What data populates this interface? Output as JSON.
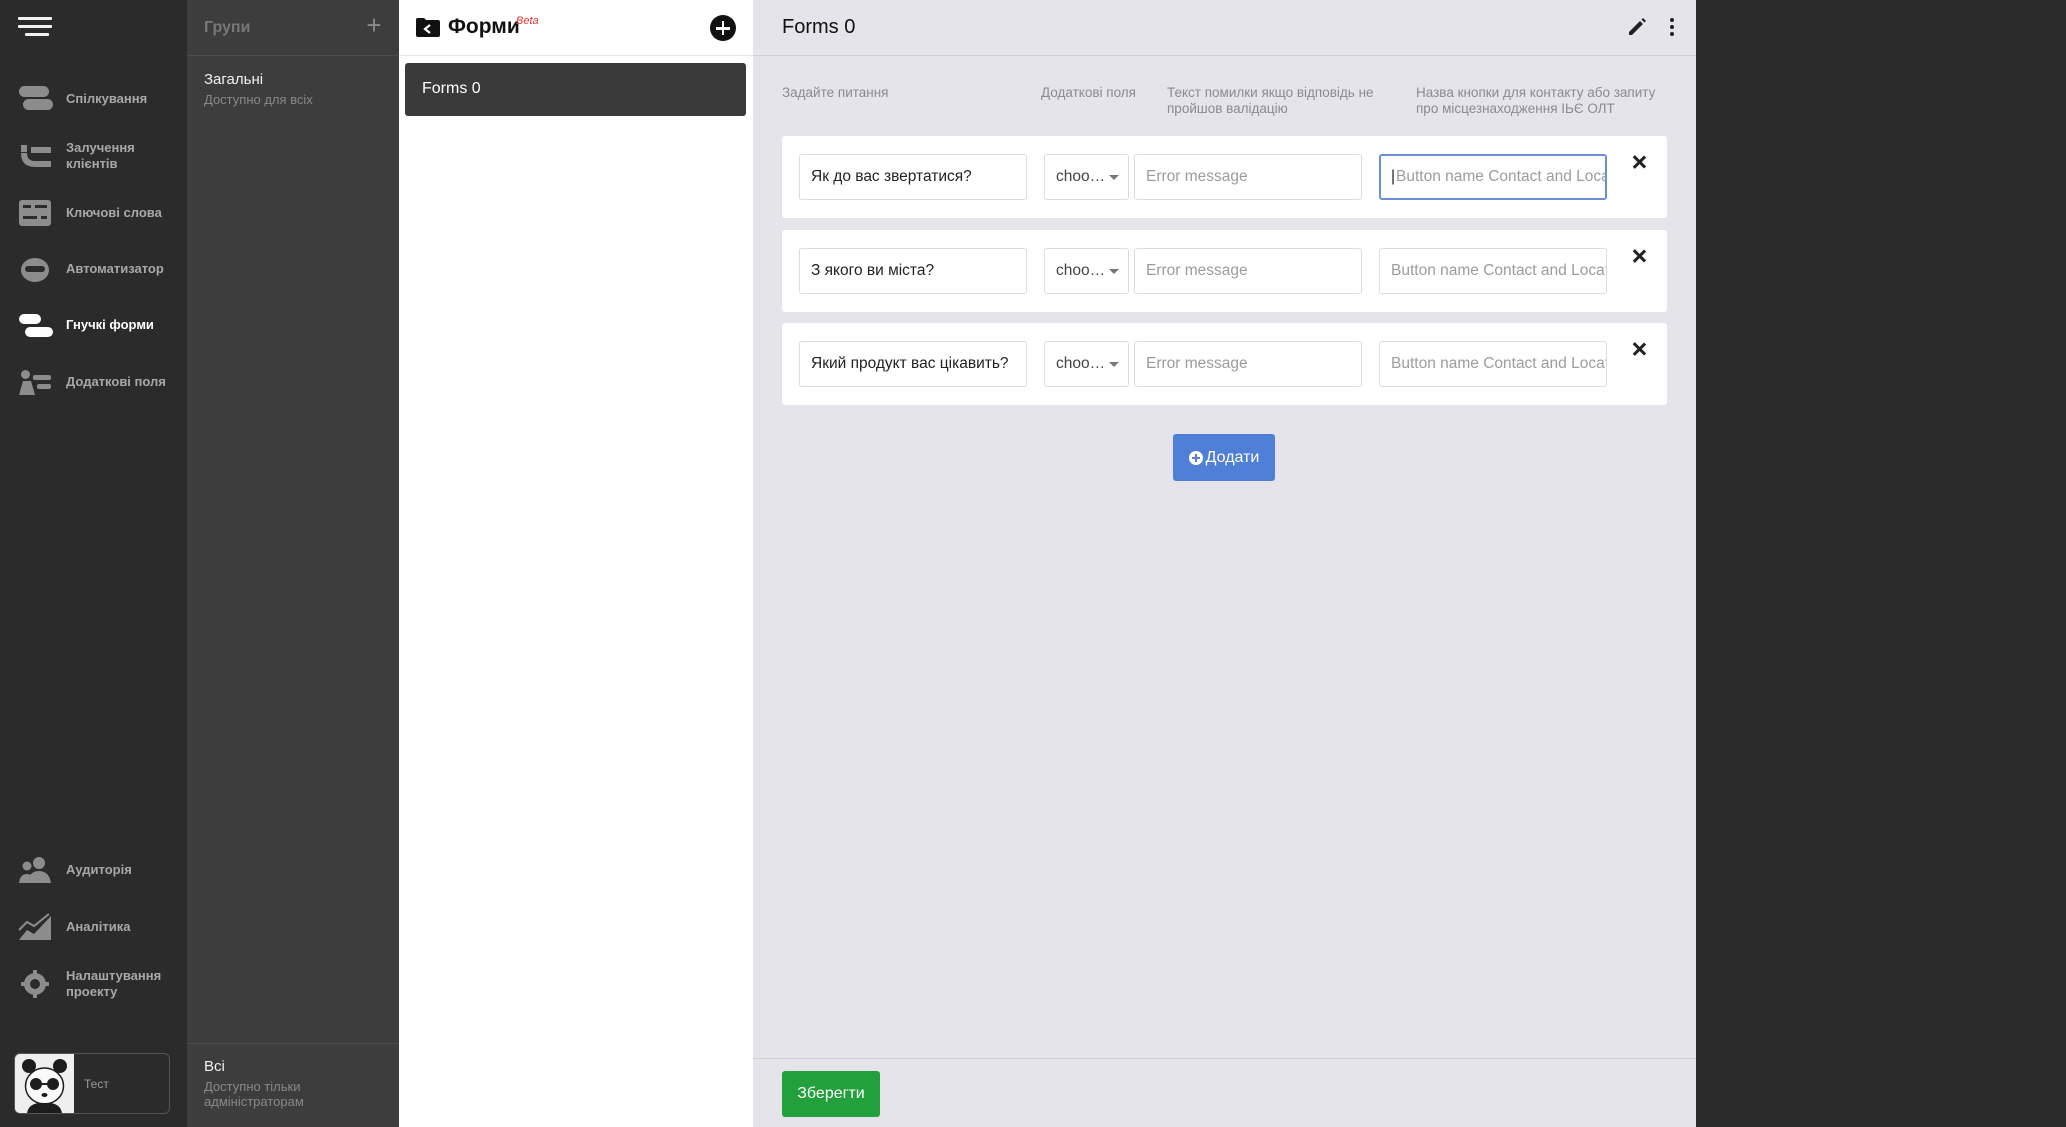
{
  "nav": {
    "items": [
      {
        "label": "Спілкування",
        "icon": "chat-icon"
      },
      {
        "label": "Залучення клієнтів",
        "icon": "magnet-icon"
      },
      {
        "label": "Ключові слова",
        "icon": "keywords-icon"
      },
      {
        "label": "Автоматизатор",
        "icon": "robot-icon"
      },
      {
        "label": "Гнучкі форми",
        "icon": "forms-icon",
        "active": true
      },
      {
        "label": "Додаткові поля",
        "icon": "fields-icon"
      },
      {
        "label": "Аудиторія",
        "icon": "audience-icon"
      },
      {
        "label": "Аналітика",
        "icon": "analytics-icon"
      },
      {
        "label": "Налаштування проекту",
        "icon": "settings-gear-icon"
      }
    ],
    "user": {
      "name": "Тест"
    }
  },
  "groups": {
    "title": "Групи",
    "items": [
      {
        "name": "Загальні",
        "sub": "Доступно для всіх"
      }
    ],
    "bottom": {
      "name": "Всі",
      "sub": "Доступно тільки адміністраторам"
    }
  },
  "forms_list": {
    "title": "Форми",
    "badge": "Beta",
    "items": [
      "Forms 0"
    ]
  },
  "editor": {
    "title": "Forms 0",
    "columns": {
      "question": "Задайте питання",
      "extra": "Додаткові поля",
      "error": "Текст помилки якщо відповідь не пройшов валідацію",
      "button": "Назва кнопки для контакту або запиту про місцезнаходження IЬЄ ОЛТ"
    },
    "rows": [
      {
        "question": "Як до вас звертатися?",
        "select": "choo…",
        "error_placeholder": "Error message",
        "button_placeholder": "Button name Contact and Location"
      },
      {
        "question": "З якого ви міста?",
        "select": "choo…",
        "error_placeholder": "Error message",
        "button_placeholder": "Button name Contact and Location"
      },
      {
        "question": "Який продукт вас цікавить?",
        "select": "choo…",
        "error_placeholder": "Error message",
        "button_placeholder": "Button name Contact and Location"
      }
    ],
    "add_label": "Додати",
    "save_label": "Зберегти"
  },
  "colors": {
    "accent_blue": "#4f7fd6",
    "save_green": "#22a03c",
    "beta_red": "#e03a3a"
  }
}
